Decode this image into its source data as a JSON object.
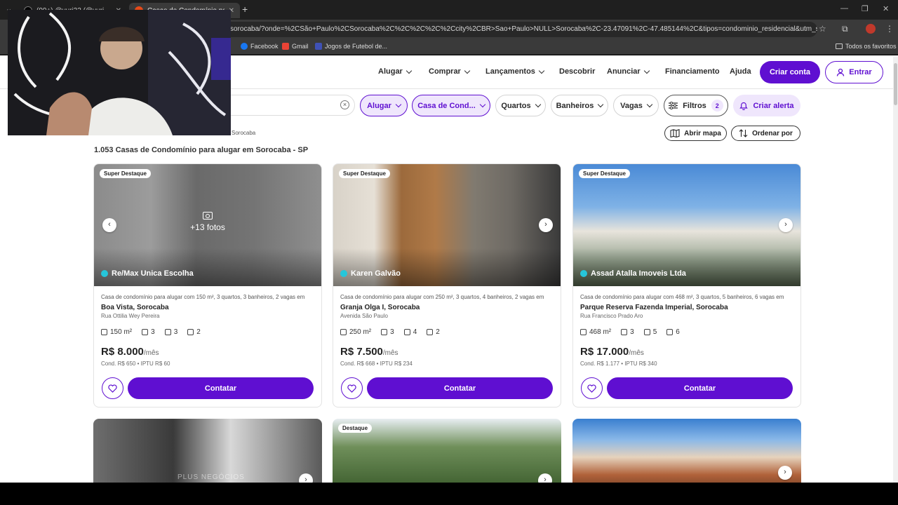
{
  "browser": {
    "tabs": [
      {
        "title": "(99+) @yuri22 (@yuri...",
        "active": false
      },
      {
        "title": "Casas de Condomínio para alug...",
        "active": true
      }
    ],
    "url": "sorocaba/?onde=%2CSão+Paulo%2CSorocaba%2C%2C%2C%2C%2Ccity%2CBR>Sao+Paulo>NULL>Sorocaba%2C-23.47091%2C-47.485144%2C&tipos=condominio_residencial&utm_source=google&...",
    "bookmarks": [
      "Facebook",
      "Gmail",
      "Jogos de Futebol de..."
    ],
    "all_bookmarks": "Todos os favoritos"
  },
  "nav": {
    "items": [
      "Alugar",
      "Comprar",
      "Lançamentos",
      "Descobrir",
      "Anunciar",
      "Financiamento",
      "Ajuda"
    ],
    "create_account": "Criar conta",
    "login": "Entrar"
  },
  "filters": {
    "type": "Alugar",
    "property": "Casa de Cond...",
    "rooms": "Quartos",
    "baths": "Banheiros",
    "parking": "Vagas",
    "filters_label": "Filtros",
    "filters_count": "2",
    "alert": "Criar alerta"
  },
  "breadcrumb": "Sorocaba",
  "tools": {
    "map": "Abrir mapa",
    "sort": "Ordenar por"
  },
  "result_title": "1.053 Casas de Condomínio para alugar em Sorocaba - SP",
  "colors": {
    "accent": "#5f0fd1",
    "accent_light": "#efe6fc"
  },
  "cards": [
    {
      "badge": "Super Destaque",
      "agency": "Re/Max Unica Escolha",
      "more_photos": "+13 fotos",
      "desc": "Casa de condomínio para alugar com 150 m², 3 quartos, 3 banheiros, 2 vagas em",
      "location": "Boa Vista, Sorocaba",
      "street": "Rua Ottilia Wey Pereira",
      "area": "150 m²",
      "rooms": "3",
      "baths": "3",
      "parking": "2",
      "price": "R$ 8.000",
      "per": "/mês",
      "cond": "Cond. R$ 650 • IPTU R$ 60",
      "contact": "Contatar"
    },
    {
      "badge": "Super Destaque",
      "agency": "Karen Galvão",
      "desc": "Casa de condomínio para alugar com 250 m², 3 quartos, 4 banheiros, 2 vagas em",
      "location": "Granja Olga I, Sorocaba",
      "street": "Avenida São Paulo",
      "area": "250 m²",
      "rooms": "3",
      "baths": "4",
      "parking": "2",
      "price": "R$ 7.500",
      "per": "/mês",
      "cond": "Cond. R$ 668 • IPTU R$ 234",
      "contact": "Contatar"
    },
    {
      "badge": "Super Destaque",
      "agency": "Assad Atalla Imoveis Ltda",
      "desc": "Casa de condomínio para alugar com 468 m², 3 quartos, 5 banheiros, 6 vagas em",
      "location": "Parque Reserva Fazenda Imperial, Sorocaba",
      "street": "Rua Francisco Prado Aro",
      "area": "468 m²",
      "rooms": "3",
      "baths": "5",
      "parking": "6",
      "price": "R$ 17.000",
      "per": "/mês",
      "cond": "Cond. R$ 1.177 • IPTU R$ 340",
      "contact": "Contatar"
    }
  ],
  "second_row": {
    "badge": "Destaque",
    "watermark": "PLUS NEGÓCIOS"
  }
}
